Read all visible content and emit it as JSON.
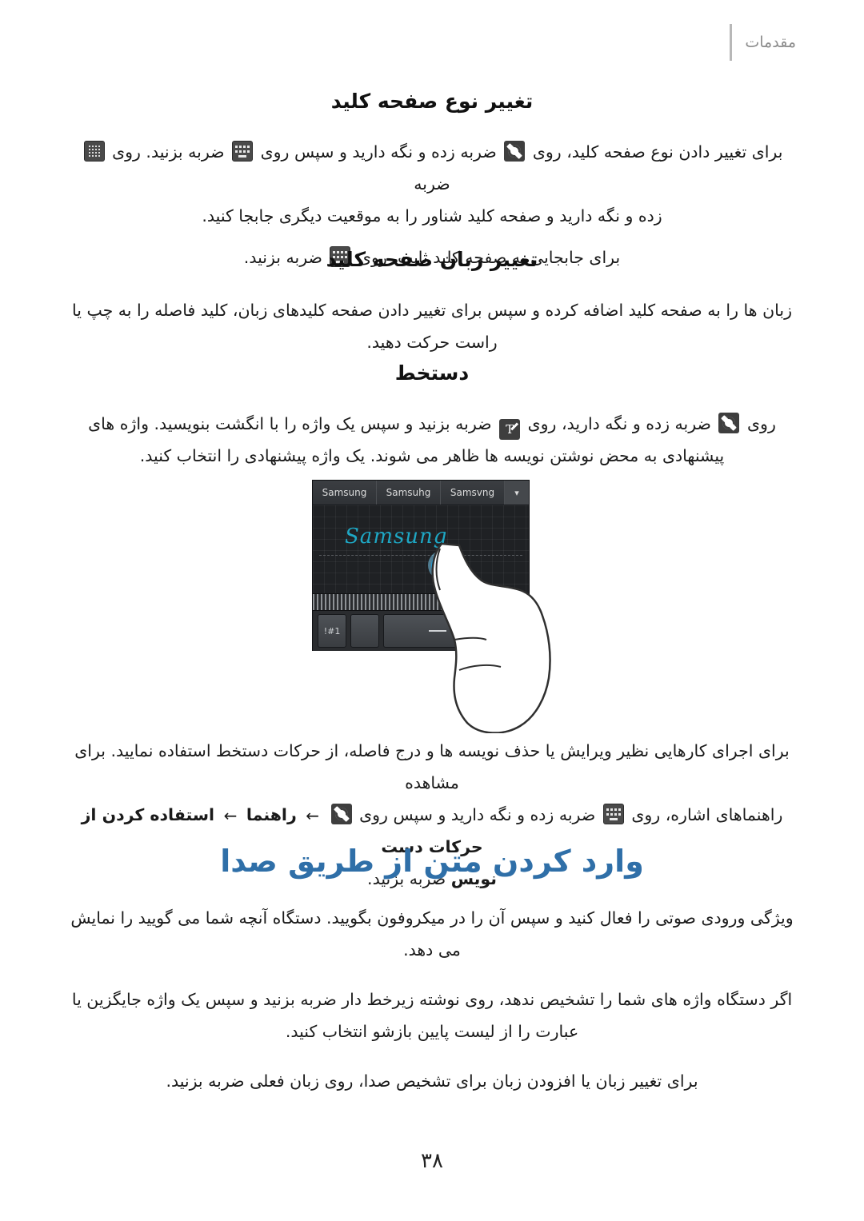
{
  "header": {
    "title": "مقدمات"
  },
  "sections": [
    {
      "id": "keyboard-type",
      "title": "تغییر نوع صفحه کلید",
      "paragraphs": [
        "برای تغییر دادن نوع صفحه کلید، روی  ضربه زده و نگه دارید و سپس روی  ضربه بزنید. روی  ضربه زده و نگه دارید و صفحه کلید شناور را به موقعیت دیگری جابجا کنید.",
        "برای جابجایی به صفحه کلید ثابت، روی  ضربه بزنید."
      ]
    },
    {
      "id": "keyboard-language",
      "title": "تغییر زبان صفحه کلید",
      "paragraphs": [
        "زبان ها را به صفحه کلید اضافه کرده و سپس برای تغییر دادن صفحه کلیدهای زبان، کلید فاصله را به چپ یا راست حرکت دهید."
      ]
    },
    {
      "id": "handwriting",
      "title": "دستخط",
      "paragraphs": [
        "روی  ضربه زده و نگه دارید، روی  ضربه بزنید و سپس یک واژه را با انگشت بنویسید. واژه های پیشنهادی به محض نوشتن نویسه ها ظاهر می شوند. یک واژه پیشنهادی را انتخاب کنید.",
        "برای اجرای کارهایی نظیر ویرایش یا حذف نویسه ها و درج فاصله، از حرکات دستخط استفاده نمایید. برای مشاهده راهنماهای اشاره، روی  ضربه زده و نگه دارید و سپس روی  ←  راهنما  ←  استفاده کردن از حرکات دست  ←  نویس  ضربه بزنید."
      ],
      "bold_trail": "استفاده کردن از حرکات دست",
      "bold_guide": "راهنما",
      "bold_note": "نویس"
    },
    {
      "id": "voice-input",
      "title": "وارد کردن متن از طریق صدا",
      "paragraphs": [
        "ویژگی ورودی صوتی را فعال کنید و سپس آن را در میکروفون بگویید. دستگاه آنچه شما می گویید را نمایش می دهد.",
        "اگر دستگاه واژه های شما را تشخیص ندهد، روی نوشته زیرخط دار ضربه بزنید و سپس یک واژه جایگزین یا عبارت را از لیست پایین بازشو انتخاب کنید.",
        "برای تغییر زبان یا افزودن زبان برای تشخیص صدا، روی زبان فعلی ضربه بزنید."
      ]
    }
  ],
  "illustration": {
    "candidates": [
      "Samsung",
      "Samsuhg",
      "Samsvng"
    ],
    "dropdown_icon": "chevron-down-icon",
    "handwriting_text": "Samsung",
    "keys": {
      "key1": "!#1",
      "key2": "",
      "space": "space-bar",
      "key4": "return"
    }
  },
  "footer": {
    "page_number": "۳۸"
  }
}
